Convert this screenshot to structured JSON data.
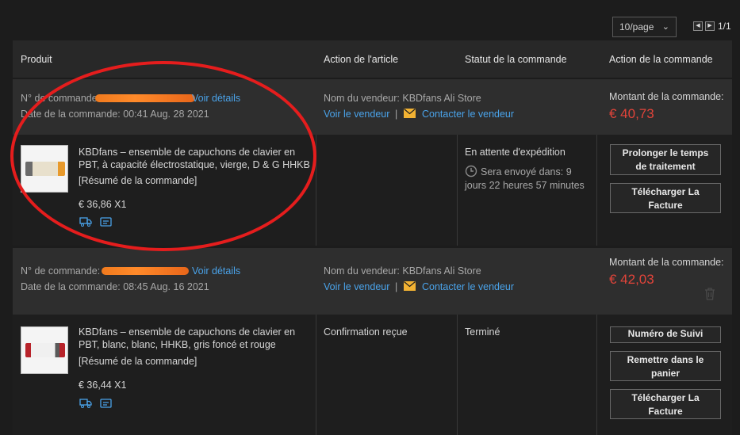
{
  "pagination": {
    "per_page": "10/page",
    "page_info": "1/1"
  },
  "table": {
    "headers": [
      "Produit",
      "Action de l'article",
      "Statut de la commande",
      "Action de la commande"
    ]
  },
  "orders": [
    {
      "order_label": "N° de commande:",
      "details_link": "Voir détails",
      "date_text": "Date de la commande: 00:41 Aug. 28 2021",
      "seller_text": "Nom du vendeur: KBDfans Ali Store",
      "view_seller": "Voir le vendeur",
      "separator": "|",
      "contact_seller": "Contacter le vendeur",
      "amount_label": "Montant de la commande:",
      "amount": "€ 40,73",
      "product_title_1": "KBDfans – ensemble de capuchons de clavier en",
      "product_title_2": "PBT, à capacité électrostatique, vierge, D & G HHKB",
      "summary": "[Résumé de la commande]",
      "price_qty": "€ 36,86 X1",
      "item_action": "",
      "status": "En attente d'expédition",
      "status_detail_1": "Sera envoyé dans: 9",
      "status_detail_2": "jours 22 heures 57 minutes",
      "btn_1_line1": "Prolonger le temps",
      "btn_1_line2": "de traitement",
      "btn_2_line1": "Télécharger La",
      "btn_2_line2": "Facture"
    },
    {
      "order_label": "N° de commande:",
      "details_link": "Voir détails",
      "date_text": "Date de la commande: 08:45 Aug. 16 2021",
      "seller_text": "Nom du vendeur: KBDfans Ali Store",
      "view_seller": "Voir le vendeur",
      "separator": "|",
      "contact_seller": "Contacter le vendeur",
      "amount_label": "Montant de la commande:",
      "amount": "€ 42,03",
      "product_title_1": "KBDfans – ensemble de capuchons de clavier en",
      "product_title_2": "PBT, blanc, blanc, HHKB, gris foncé et rouge",
      "summary": "[Résumé de la commande]",
      "price_qty": "€ 36,44 X1",
      "item_action": "Confirmation reçue",
      "status": "Terminé",
      "btn_1_line1": "Numéro de Suivi",
      "btn_2_line1": "Remettre dans le",
      "btn_2_line2": "panier",
      "btn_3_line1": "Télécharger La",
      "btn_3_line2": "Facture"
    }
  ],
  "colors": {
    "accent_link": "#4aa3ea",
    "price": "#e2443a",
    "annotation": "#e51d1d",
    "redaction": "#f07a1e"
  },
  "icons": [
    "chevron-down-icon",
    "prev-page-icon",
    "next-page-icon",
    "envelope-icon",
    "clock-icon",
    "trash-icon",
    "truck-icon",
    "receipt-icon"
  ]
}
